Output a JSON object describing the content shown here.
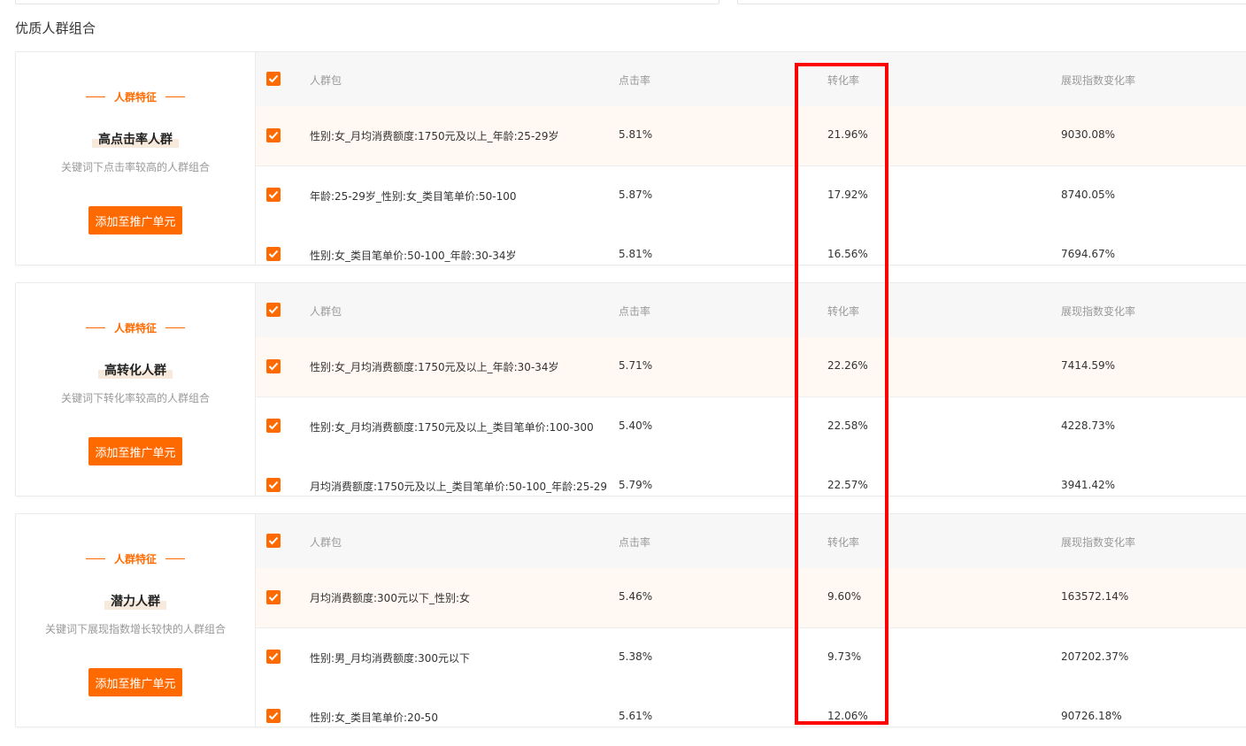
{
  "section_title": "优质人群组合",
  "feature_label": "人群特征",
  "add_button_label": "添加至推广单元",
  "columns": {
    "name": "人群包",
    "ctr": "点击率",
    "cvr": "转化率",
    "exposure_change": "展现指数变化率"
  },
  "groups": [
    {
      "name": "高点击率人群",
      "description": "关键词下点击率较高的人群组合",
      "rows": [
        {
          "name": "性别:女_月均消费额度:1750元及以上_年龄:25-29岁",
          "ctr": "5.81%",
          "cvr": "21.96%",
          "exposure_change": "9030.08%",
          "checked": true
        },
        {
          "name": "年龄:25-29岁_性别:女_类目笔单价:50-100",
          "ctr": "5.87%",
          "cvr": "17.92%",
          "exposure_change": "8740.05%",
          "checked": true
        },
        {
          "name": "性别:女_类目笔单价:50-100_年龄:30-34岁",
          "ctr": "5.81%",
          "cvr": "16.56%",
          "exposure_change": "7694.67%",
          "checked": true
        }
      ]
    },
    {
      "name": "高转化人群",
      "description": "关键词下转化率较高的人群组合",
      "rows": [
        {
          "name": "性别:女_月均消费额度:1750元及以上_年龄:30-34岁",
          "ctr": "5.71%",
          "cvr": "22.26%",
          "exposure_change": "7414.59%",
          "checked": true
        },
        {
          "name": "性别:女_月均消费额度:1750元及以上_类目笔单价:100-300",
          "ctr": "5.40%",
          "cvr": "22.58%",
          "exposure_change": "4228.73%",
          "checked": true
        },
        {
          "name": "月均消费额度:1750元及以上_类目笔单价:50-100_年龄:25-29",
          "ctr": "5.79%",
          "cvr": "22.57%",
          "exposure_change": "3941.42%",
          "checked": true
        }
      ]
    },
    {
      "name": "潜力人群",
      "description": "关键词下展现指数增长较快的人群组合",
      "rows": [
        {
          "name": "月均消费额度:300元以下_性别:女",
          "ctr": "5.46%",
          "cvr": "9.60%",
          "exposure_change": "163572.14%",
          "checked": true
        },
        {
          "name": "性别:男_月均消费额度:300元以下",
          "ctr": "5.38%",
          "cvr": "9.73%",
          "exposure_change": "207202.37%",
          "checked": true
        },
        {
          "name": "性别:女_类目笔单价:20-50",
          "ctr": "5.61%",
          "cvr": "12.06%",
          "exposure_change": "90726.18%",
          "checked": true
        }
      ]
    }
  ],
  "colors": {
    "accent": "#ff6a00",
    "highlight_row": "#fff8f3",
    "annotation_box": "#ff0000"
  }
}
